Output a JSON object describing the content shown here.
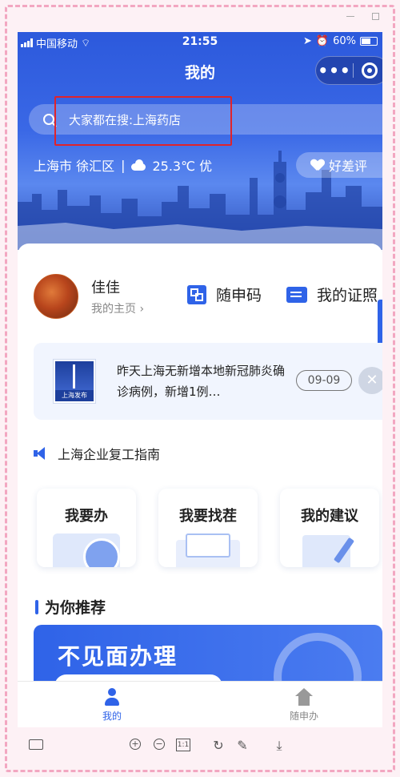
{
  "status_bar": {
    "carrier": "中国移动",
    "time": "21:55",
    "battery": "60%"
  },
  "nav": {
    "title": "我的",
    "menu_label": "•••"
  },
  "search": {
    "placeholder": "大家都在搜:上海药店"
  },
  "weather": {
    "location": "上海市 徐汇区",
    "divider": "|",
    "temperature": "25.3℃ 优"
  },
  "rate_button": {
    "label": "好差评"
  },
  "profile": {
    "name": "佳佳",
    "homepage_link": "我的主页 ›"
  },
  "quick_actions": [
    {
      "label": "随申码",
      "icon": "qr-code-icon"
    },
    {
      "label": "我的证照",
      "icon": "id-card-icon"
    }
  ],
  "news": {
    "source_logo_text": "上海发布",
    "text": "昨天上海无新增本地新冠肺炎确诊病例，新增1例…",
    "date": "09-09",
    "close_label": "✕"
  },
  "announcement": {
    "label": "上海企业复工指南"
  },
  "service_tiles": [
    {
      "label": "我要办"
    },
    {
      "label": "我要找茬"
    },
    {
      "label": "我的建议"
    }
  ],
  "recommend": {
    "title": "为你推荐",
    "banner_title": "不见面办理"
  },
  "tabbar": {
    "tabs": [
      {
        "label": "我的",
        "active": true
      },
      {
        "label": "随申办",
        "active": false
      }
    ]
  },
  "toolbar": {
    "zoom_in": "+",
    "zoom_out": "−",
    "actual_size": "1:1",
    "rotate": "↻",
    "edit": "✎",
    "download": "⤓"
  },
  "colors": {
    "primary": "#2f63e8",
    "highlight": "#e0232b",
    "frame": "#f2a7c1"
  }
}
